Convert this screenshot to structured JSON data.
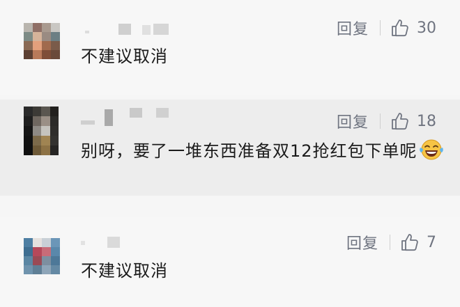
{
  "comments": [
    {
      "text": "不建议取消",
      "reply_label": "回复",
      "like_icon": "thumbs-up-icon",
      "like_count": "30"
    },
    {
      "text": "别呀，要了一堆东西准备双12抢红包下单呢",
      "emoji": "tears-of-joy-emoji",
      "reply_label": "回复",
      "like_icon": "thumbs-up-icon",
      "like_count": "18"
    },
    {
      "text": "不建议取消",
      "reply_label": "回复",
      "like_icon": "thumbs-up-icon",
      "like_count": "7"
    }
  ],
  "colors": {
    "text": "#1b1b1b",
    "action_gray": "#6f7480",
    "highlight_row": "#ededed",
    "background": "#f7f7f7"
  }
}
